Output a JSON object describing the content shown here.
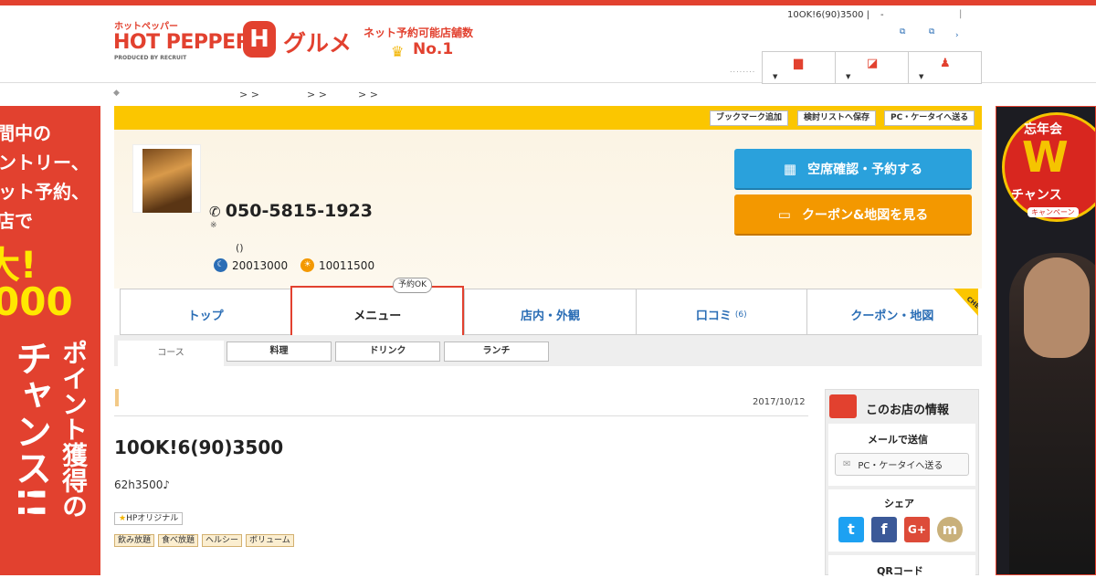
{
  "header": {
    "logo_small": "ホットペッパー",
    "logo_main": "HOT PEPPER",
    "logo_produced": "PRODUCED BY RECRUIT",
    "logo_h": "H",
    "logo_gourmet": "グルメ",
    "net_no1": "ネット予約可能店舗数",
    "no1": "No.1",
    "promo": "10OK!6(90)3500 |",
    "dash": "-",
    "pipe": "|",
    "dots": "........"
  },
  "breadcrumb": {
    "back": "◆",
    "sep1": "> >",
    "sep2": "> >",
    "sep3": "> >"
  },
  "strip": {
    "bookmark": "ブックマーク追加",
    "save_list": "検討リストへ保存",
    "send_pc": "PC・ケータイへ送る"
  },
  "shop": {
    "phone": "050-5815-1923",
    "phone_note": "※",
    "paren": "()",
    "hours_night": "20013000",
    "hours_day": "10011500",
    "reserve_button": "空席確認・予約する",
    "coupon_button": "クーポン&地図を見る"
  },
  "tabs": [
    {
      "label": "トップ"
    },
    {
      "label": "メニュー"
    },
    {
      "label": "店内・外観"
    },
    {
      "label": "口コミ",
      "count": "(6)"
    },
    {
      "label": "クーポン・地図"
    }
  ],
  "tab_badge": "予約OK",
  "tab_check": "CHECK",
  "subtabs": [
    "コース",
    "料理",
    "ドリンク",
    "ランチ"
  ],
  "content": {
    "date": "2017/10/12",
    "title": "10OK!6(90)3500",
    "body": "62h3500♪",
    "hp_tag": "HPオリジナル",
    "tags": [
      "飲み放題",
      "食べ放題",
      "ヘルシー",
      "ボリューム"
    ]
  },
  "sidebar": {
    "title": "このお店の情報",
    "mail_title": "メールで送信",
    "mail_button": "PC・ケータイへ送る",
    "share_title": "シェア",
    "qr_title": "QRコード"
  },
  "left_banner": {
    "lines": [
      "間中の",
      "ントリー、",
      "ット予約、",
      "店で",
      "大!",
      "000",
      "ポイント獲得の",
      "チャンス!!"
    ]
  },
  "right_banner": {
    "t1": "忘年会",
    "w": "W",
    "t2": "チャンス",
    "t3": "キャンペーン"
  },
  "colors": {
    "brand_red": "#e2412f",
    "strip_yellow": "#fbc600",
    "reserve_blue": "#2aa1dc",
    "coupon_orange": "#f39800"
  }
}
